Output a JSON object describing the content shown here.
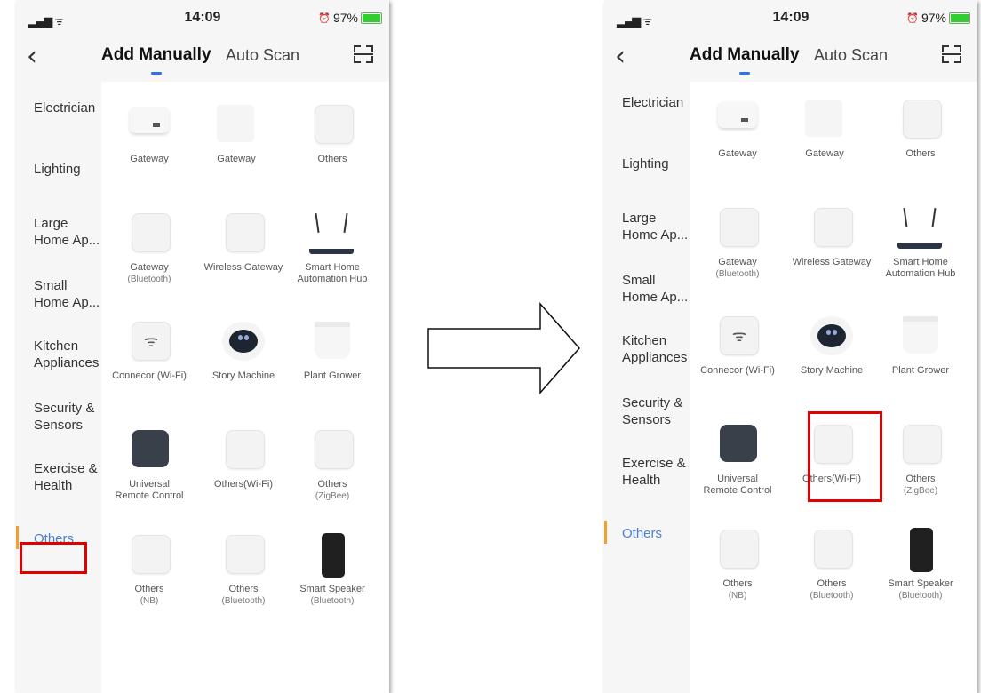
{
  "status": {
    "time": "14:09",
    "battery": "97%"
  },
  "nav": {
    "back": "‹",
    "tab_add": "Add Manually",
    "tab_auto": "Auto Scan"
  },
  "sidebar": {
    "items": [
      {
        "label": "Electrician"
      },
      {
        "label": "Lighting"
      },
      {
        "label": "Large Home Ap..."
      },
      {
        "label": "Small Home Ap..."
      },
      {
        "label": "Kitchen Appliances"
      },
      {
        "label": "Security & Sensors"
      },
      {
        "label": "Exercise & Health"
      },
      {
        "label": "Others"
      }
    ]
  },
  "devices": [
    {
      "name": "Gateway",
      "sub": ""
    },
    {
      "name": "Gateway",
      "sub": ""
    },
    {
      "name": "Others",
      "sub": ""
    },
    {
      "name": "Gateway",
      "sub": "(Bluetooth)"
    },
    {
      "name": "Wireless Gateway",
      "sub": ""
    },
    {
      "name": "Smart Home",
      "sub": "Automation Hub"
    },
    {
      "name": "Connecor (Wi-Fi)",
      "sub": ""
    },
    {
      "name": "Story Machine",
      "sub": ""
    },
    {
      "name": "Plant Grower",
      "sub": ""
    },
    {
      "name": "Universal",
      "sub": "Remote Control"
    },
    {
      "name": "Others(Wi-Fi)",
      "sub": ""
    },
    {
      "name": "Others",
      "sub": "(ZigBee)"
    },
    {
      "name": "Others",
      "sub": "(NB)"
    },
    {
      "name": "Others",
      "sub": "(Bluetooth)"
    },
    {
      "name": "Smart Speaker",
      "sub": "(Bluetooth)"
    }
  ],
  "icons": {
    "wifi": "wifi-icon",
    "signal": "signal-icon",
    "back": "chevron-left-icon",
    "scan": "scan-icon",
    "arrow": "right-arrow-icon"
  },
  "colors": {
    "accent": "#2d72e8",
    "active_text": "#4a7fd6",
    "active_bar": "#f0a030",
    "highlight": "#e00000"
  }
}
